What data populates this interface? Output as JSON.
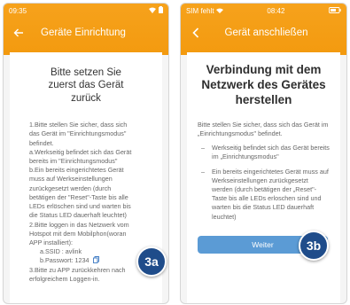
{
  "screen_a": {
    "status": {
      "time": "09:35"
    },
    "title": "Geräte Einrichtung",
    "heading": "Bitte setzen Sie zuerst das Gerät zurück",
    "body": [
      "1.Bitte stellen Sie sicher, dass sich das Gerät im \"Einrichtungsmodus\" befindet.",
      "a.Werkseitig befindet sich das Gerät bereits im \"Einrichtungsmodus\"",
      "b.Ein bereits eingerichtetes Gerät muss auf Werkseinstellungen zurückgesetzt werden (durch betätigen der \"Reset\"-Taste bis alle LEDs erlöschen sind und warten bis die Status LED dauerhaft leuchtet)",
      "2.Bitte loggen in das Netzwerk vom Hotspot mit dem Mobilphon(woran APP installiert):"
    ],
    "ssid": "a.SSID : avlink",
    "password": "b.Passwort: 1234",
    "step3": "3.Bitte zu APP zurückkehren nach erfolgreichem Loggen-in.",
    "badge": "3a",
    "icons": [
      "back-arrow-icon",
      "wifi-icon",
      "battery-icon",
      "copy-icon"
    ]
  },
  "screen_b": {
    "status": {
      "carrier": "SIM fehlt",
      "time": "08:42"
    },
    "title": "Gerät anschließen",
    "heading": "Verbindung mit dem Netzwerk des Gerätes herstellen",
    "intro": "Bitte stellen Sie sicher, dass sich das Gerät im „Einrichtungsmodus\" befindet.",
    "bullets": [
      "Werkseitig befindet sich das Gerät bereits im „Einrichtungsmodus\"",
      "Ein bereits eingerichtetes Gerät muss auf Werkseinstellungen zurückgesetzt werden (durch betätigen der „Reset\"-Taste bis alle LEDs erloschen sind und warten bis die Status LED dauerhaft leuchtet)"
    ],
    "bullet_mark": "–",
    "button_label": "Weiter",
    "badge": "3b",
    "icons": [
      "back-chevron-icon",
      "wifi-icon",
      "battery-icon"
    ]
  },
  "colors": {
    "header_orange": "#f39a0f",
    "button_blue": "#5b9bd5",
    "badge_navy": "#1f4c8a"
  }
}
